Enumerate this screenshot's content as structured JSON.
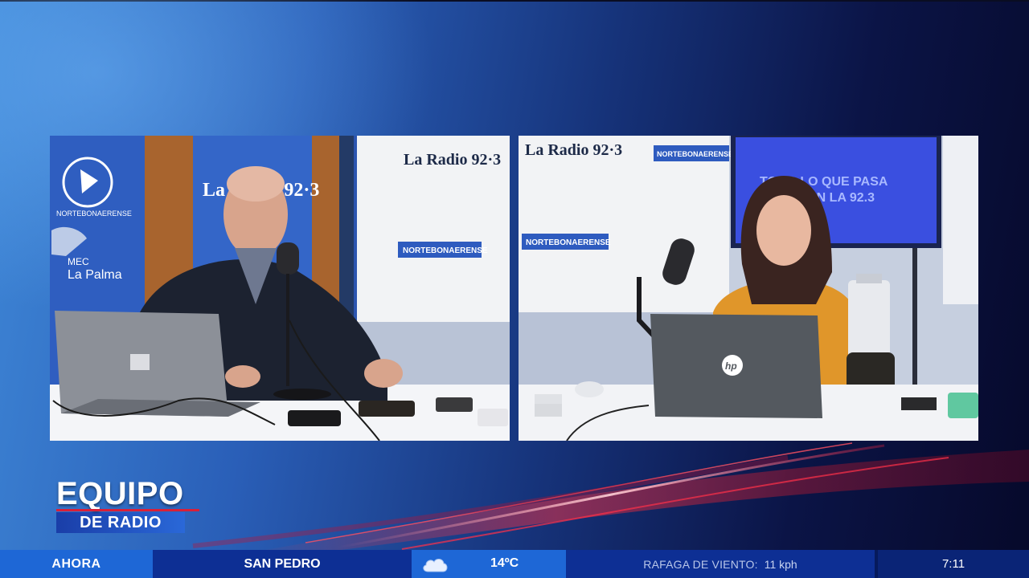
{
  "program": {
    "title_line1": "EQUIPO",
    "title_line2": "DE RADIO"
  },
  "ticker": {
    "now_label": "AHORA",
    "city": "SAN PEDRO",
    "weather_icon": "cloud-icon",
    "temperature": "14ºC",
    "wind_label": "RAFAGA DE VIENTO:",
    "wind_value": "11 kph",
    "time": "7:11"
  },
  "studio_left": {
    "logo_caption": "NORTEBONAERENSE",
    "sign_line1": "MEC",
    "sign_line2": "La Palma",
    "banner_station": "La Radio 92·3",
    "banner_sub": "NORTEBONAERENSE"
  },
  "studio_right": {
    "banner_station": "La Radio 92·3",
    "banner_sub": "NORTEBONAERENSE",
    "screen_text_line1": "TODO LO QUE PASA",
    "screen_text_line2": "EN LA 92.3",
    "laptop_brand": "hp"
  },
  "colors": {
    "accent_blue": "#1e67d6",
    "ticker_dark": "#0d2f94",
    "streak_red": "#e0203a"
  }
}
